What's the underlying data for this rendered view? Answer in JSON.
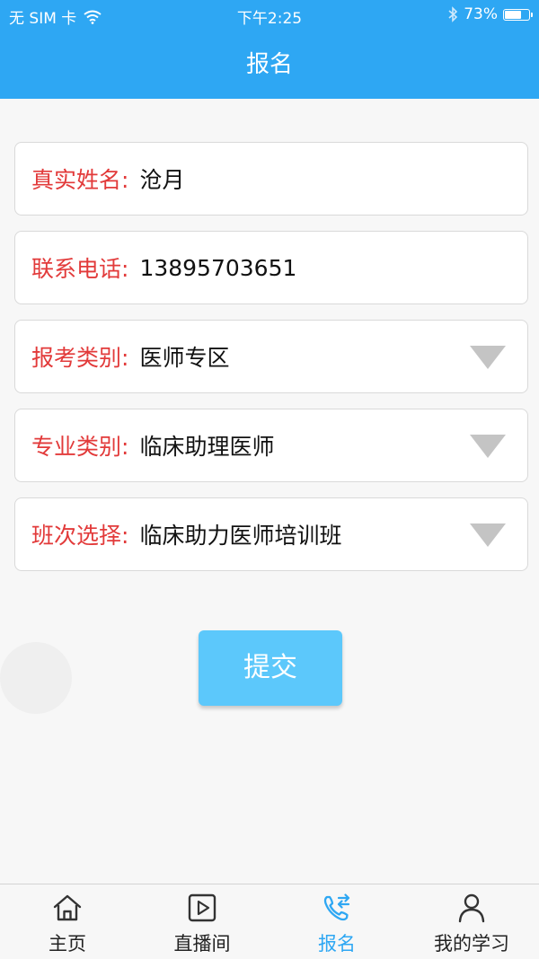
{
  "status_bar": {
    "carrier": "无 SIM 卡",
    "time": "下午2:25",
    "battery": "73%",
    "battery_level": 0.73,
    "icons": [
      "wifi-icon",
      "bluetooth-icon",
      "battery-icon"
    ]
  },
  "nav": {
    "title": "报名"
  },
  "form": {
    "name": {
      "label": "真实姓名:",
      "value": "沧月"
    },
    "phone": {
      "label": "联系电话:",
      "value": "13895703651"
    },
    "exam_type": {
      "label": "报考类别:",
      "value": "医师专区"
    },
    "major_type": {
      "label": "专业类别:",
      "value": "临床助理医师"
    },
    "class_select": {
      "label": "班次选择:",
      "value": "临床助力医师培训班"
    }
  },
  "submit_label": "提交",
  "tabs": [
    {
      "label": "主页",
      "icon": "home-icon"
    },
    {
      "label": "直播间",
      "icon": "play-icon"
    },
    {
      "label": "报名",
      "icon": "phone-transfer-icon"
    },
    {
      "label": "我的学习",
      "icon": "user-icon"
    }
  ],
  "colors": {
    "brand": "#2ea7f3",
    "label": "#e23a3a",
    "button": "#5cc8fb"
  }
}
